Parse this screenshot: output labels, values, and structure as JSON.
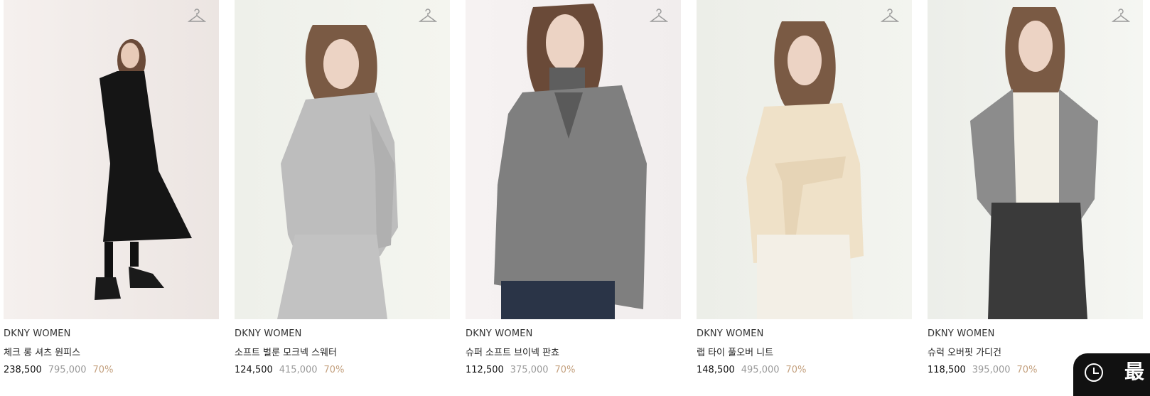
{
  "products": [
    {
      "brand": "DKNY WOMEN",
      "name": "체크 롱 셔츠 원피스",
      "price": "238,500",
      "original_price": "795,000",
      "discount": "70%"
    },
    {
      "brand": "DKNY WOMEN",
      "name": "소프트 벌룬 모크넥 스웨터",
      "price": "124,500",
      "original_price": "415,000",
      "discount": "70%"
    },
    {
      "brand": "DKNY WOMEN",
      "name": "슈퍼 소프트 브이넥 판쵸",
      "price": "112,500",
      "original_price": "375,000",
      "discount": "70%"
    },
    {
      "brand": "DKNY WOMEN",
      "name": "랩 타이 풀오버 니트",
      "price": "148,500",
      "original_price": "495,000",
      "discount": "70%"
    },
    {
      "brand": "DKNY WOMEN",
      "name": "슈럭 오버핏 가디건",
      "price": "118,500",
      "original_price": "395,000",
      "discount": "70%"
    }
  ],
  "floating_button": {
    "icon": "clock-icon",
    "text": "最"
  },
  "colors": {
    "discount": "#c4a17f",
    "original_price": "#9a9a9a"
  }
}
